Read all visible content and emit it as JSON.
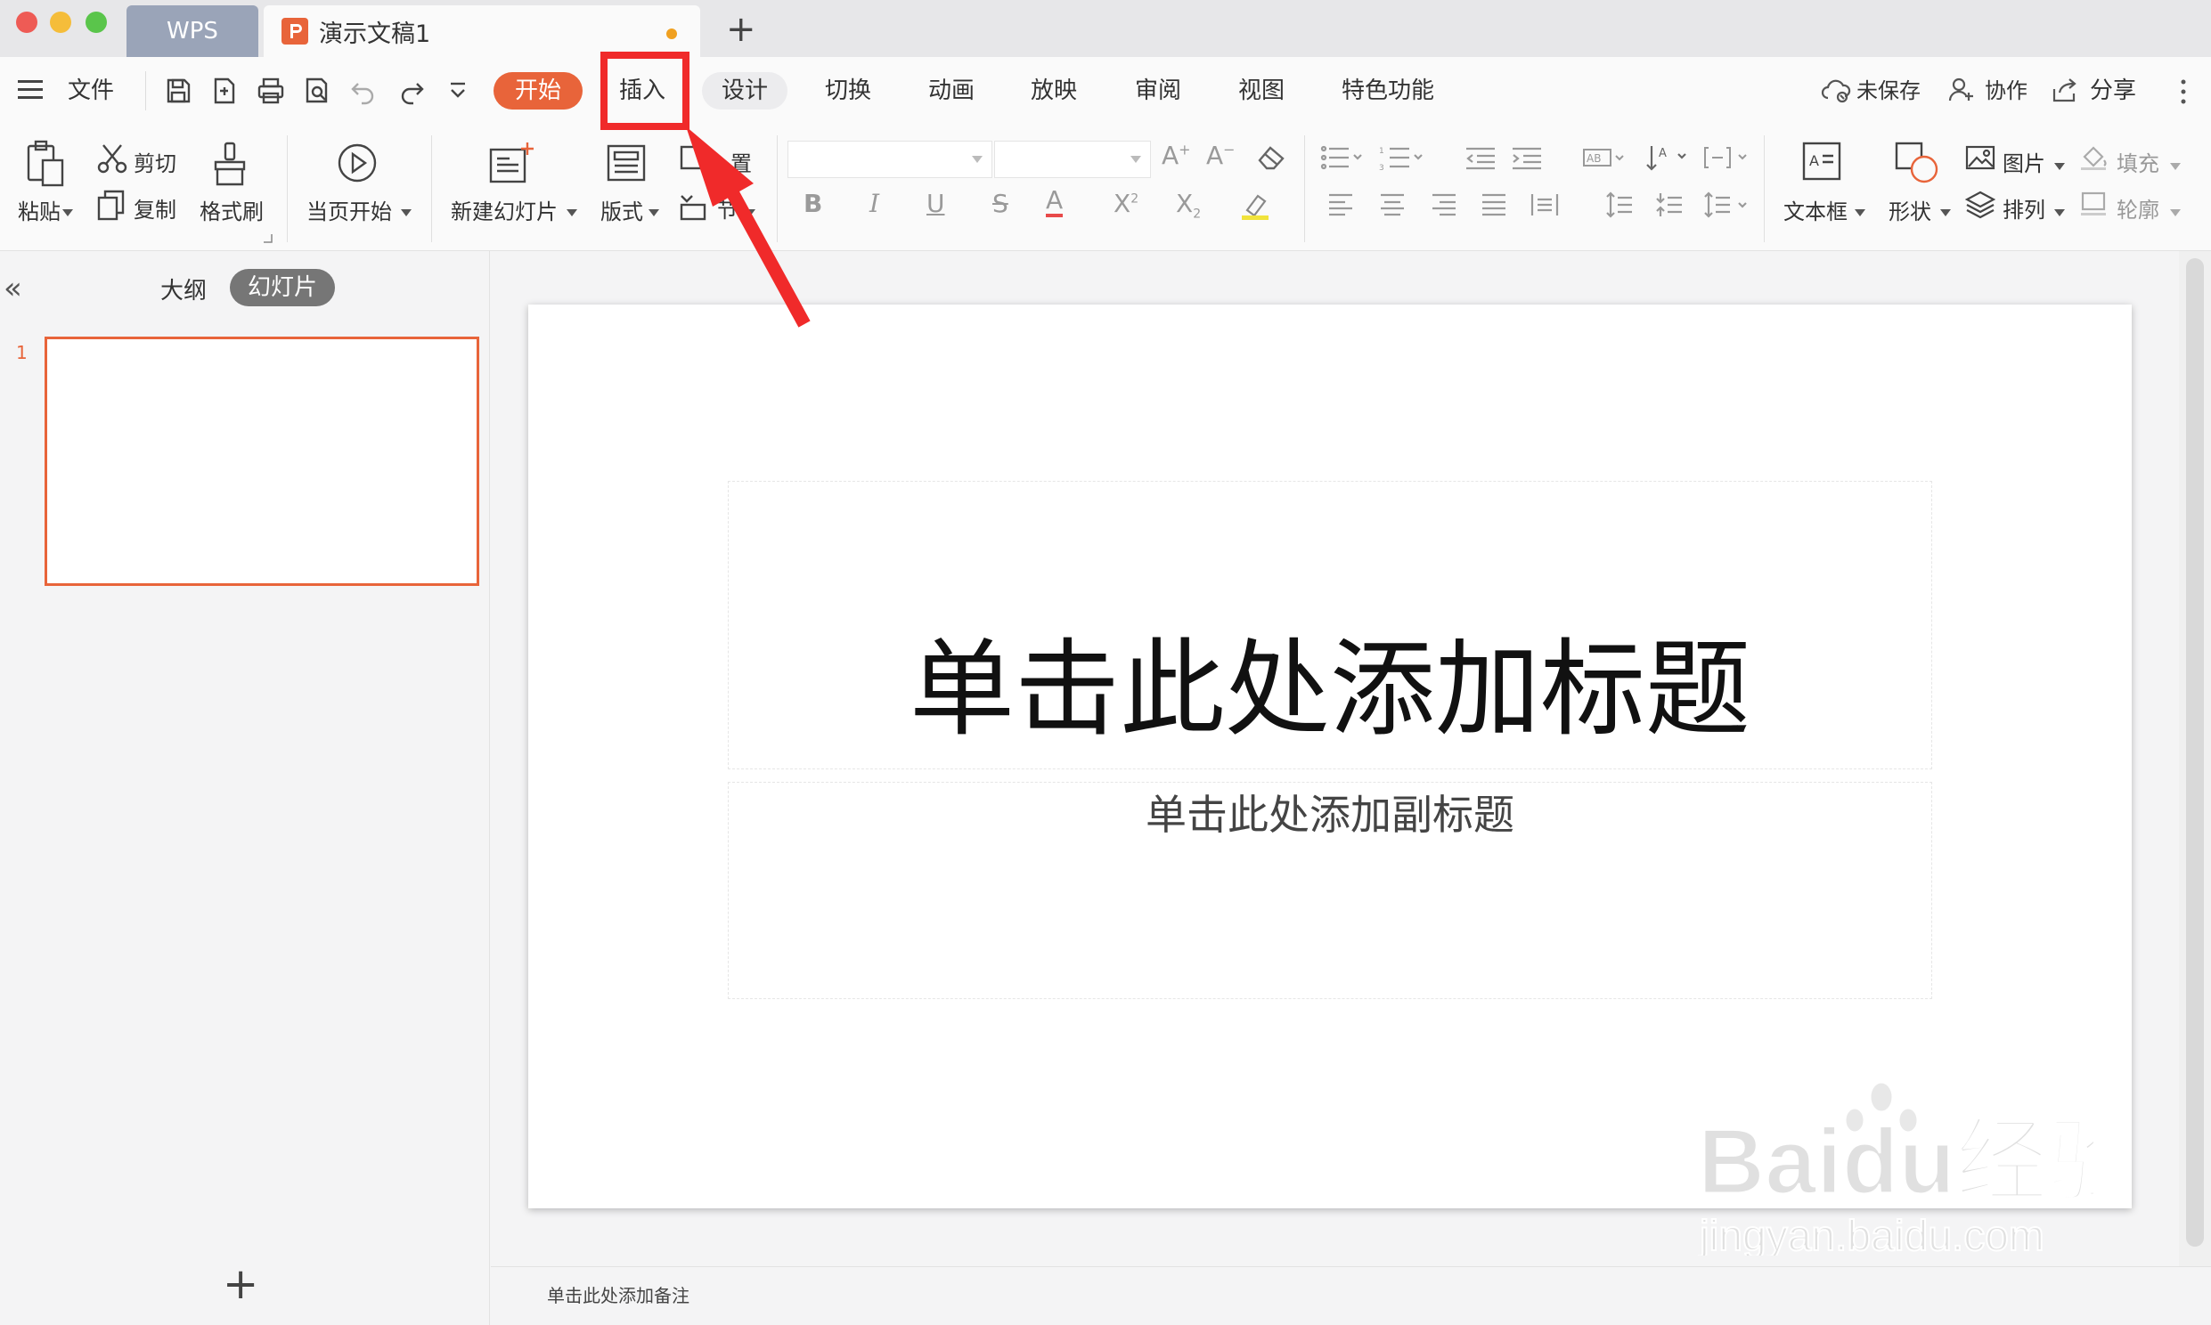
{
  "titlebar": {
    "tabs": [
      {
        "label": "WPS"
      },
      {
        "label": "演示文稿1"
      }
    ],
    "new_tab_symbol": "+"
  },
  "menubar": {
    "file_label": "文件",
    "tabs": [
      "开始",
      "插入",
      "设计",
      "切换",
      "动画",
      "放映",
      "审阅",
      "视图",
      "特色功能"
    ],
    "active_tab": "开始",
    "highlighted_tab": "插入",
    "right": {
      "unsaved_label": "未保存",
      "collab_label": "协作",
      "share_label": "分享"
    }
  },
  "ribbon": {
    "paste": "粘贴",
    "cut": "剪切",
    "copy": "复制",
    "format_painter": "格式刷",
    "start_from_current": "当页开始",
    "new_slide": "新建幻灯片",
    "layout": "版式",
    "reset": "置",
    "section": "节",
    "textbox": "文本框",
    "shape": "形状",
    "picture": "图片",
    "arrange": "排列",
    "fill": "填充",
    "outline": "轮廓"
  },
  "leftpanel": {
    "tabs": [
      "大纲",
      "幻灯片"
    ],
    "active_tab": "幻灯片",
    "slides": [
      {
        "number": "1"
      }
    ],
    "add_symbol": "+",
    "collapse_symbol": "«"
  },
  "slide": {
    "title_placeholder": "单击此处添加标题",
    "subtitle_placeholder": "单击此处添加副标题"
  },
  "notes": {
    "placeholder": "单击此处添加备注"
  },
  "watermark": {
    "brand": "Baidu经验",
    "url": "jingyan.baidu.com"
  },
  "colors": {
    "accent": "#e8643a",
    "annotation_red": "#f02a2a",
    "tab_wps_bg": "#9aa4b8"
  }
}
